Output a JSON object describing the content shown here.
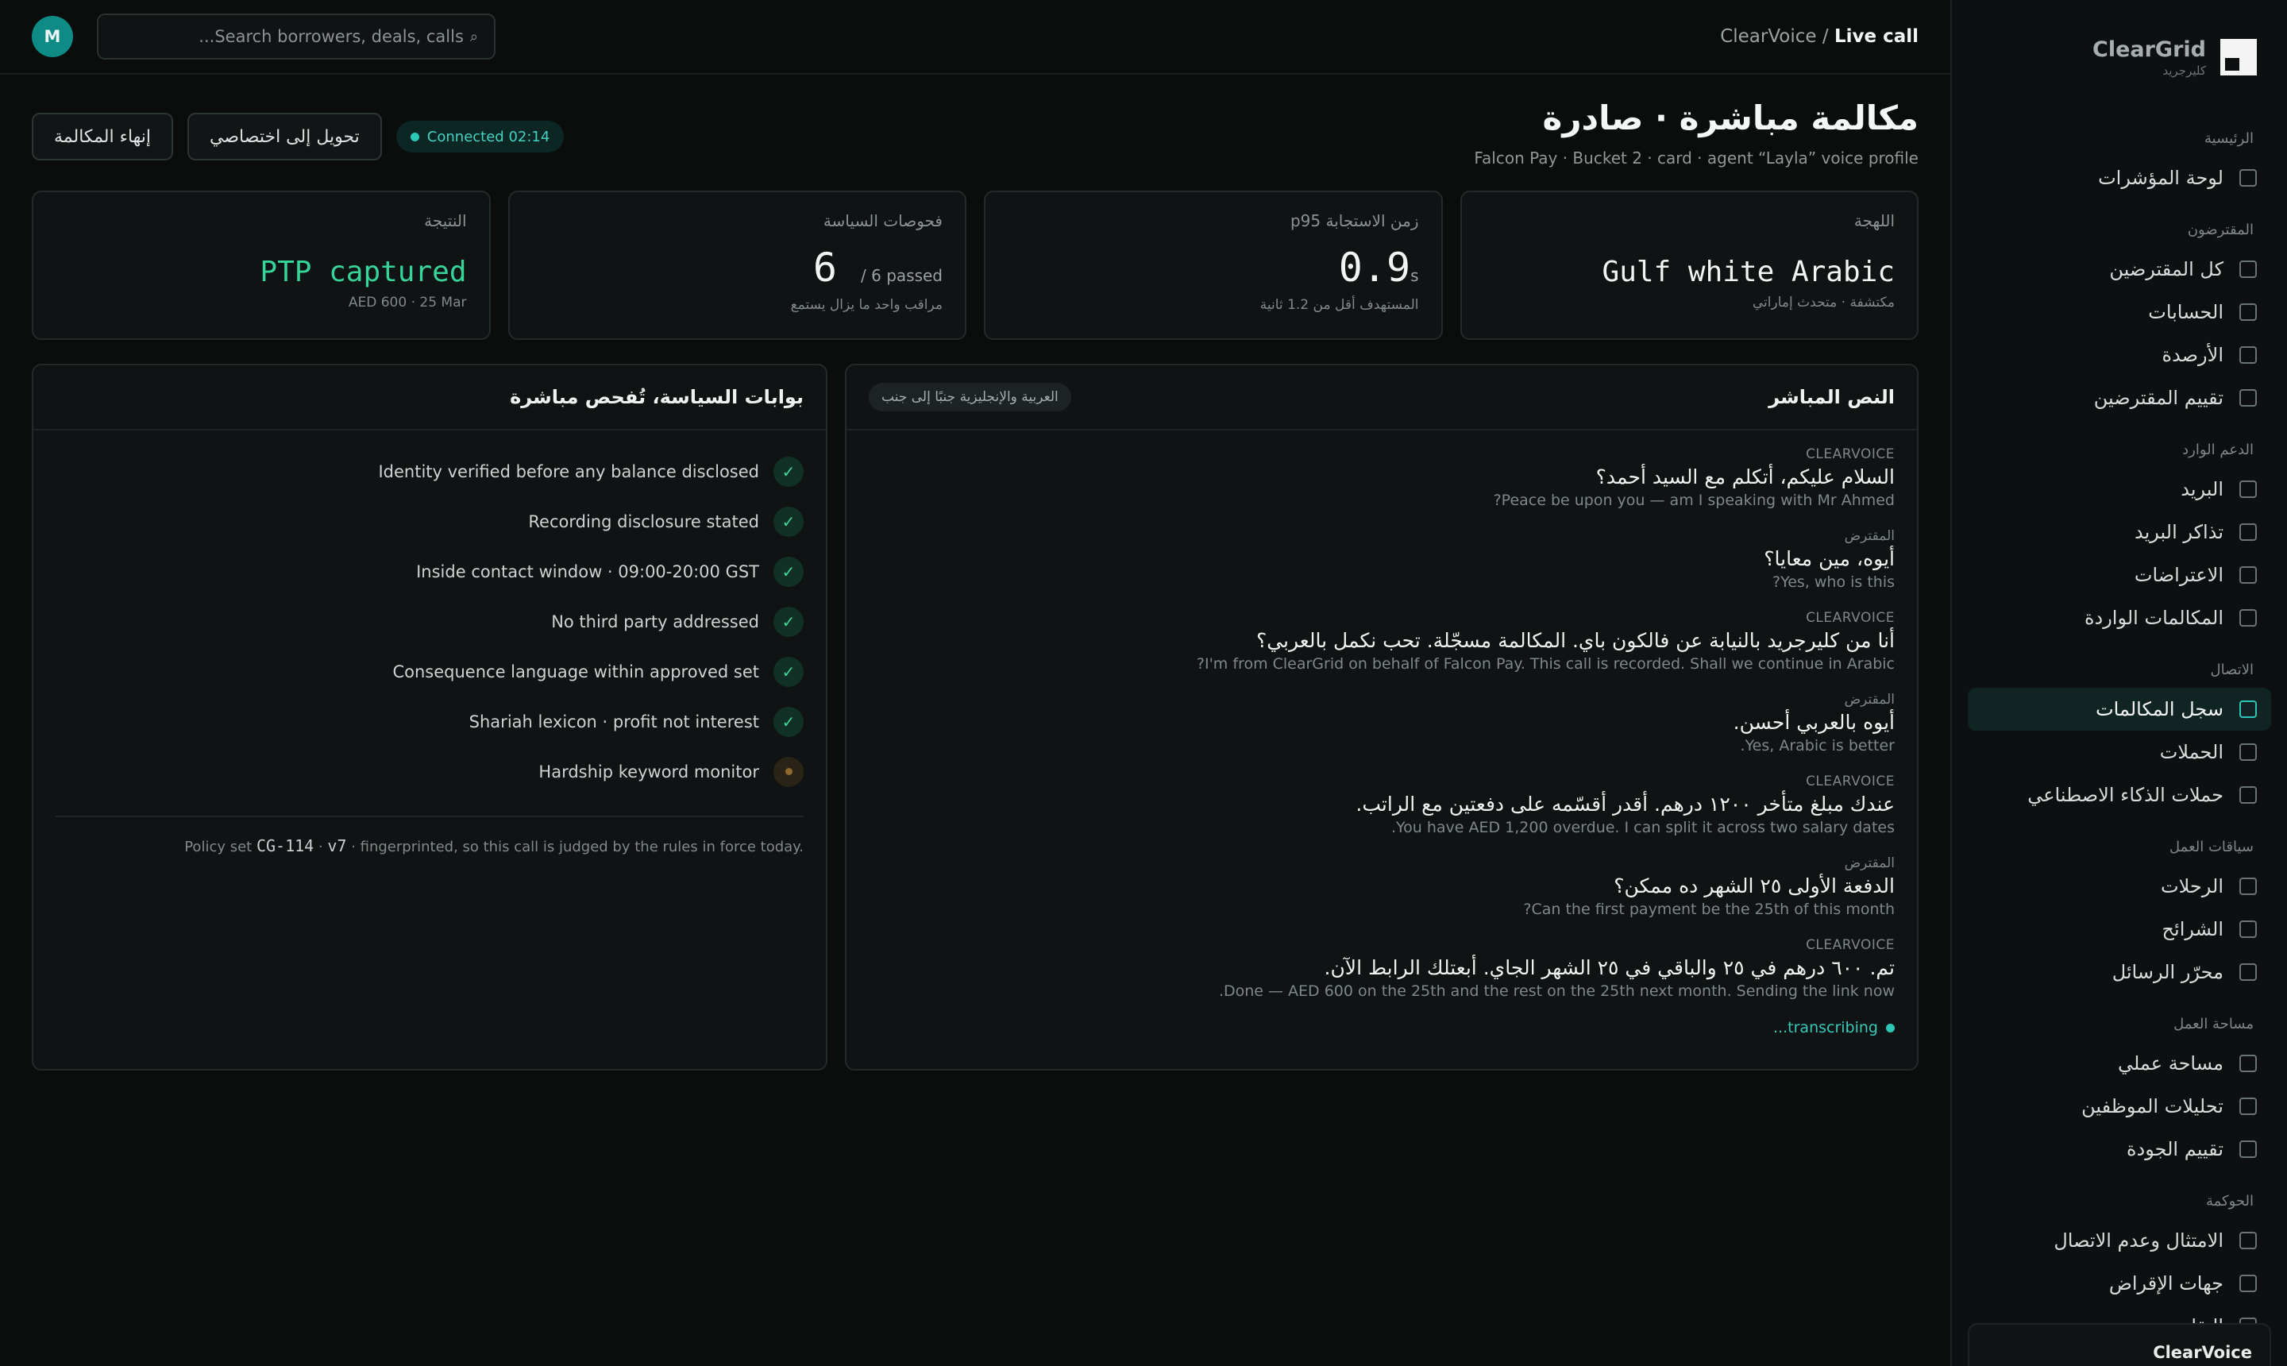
{
  "brand": {
    "name": "ClearGrid",
    "sub": "كليرجريد"
  },
  "sidebar": {
    "sections": [
      {
        "label": "الرئيسية",
        "items": [
          {
            "label": "لوحة المؤشرات",
            "active": false
          }
        ]
      },
      {
        "label": "المقترضون",
        "items": [
          {
            "label": "كل المقترضين",
            "active": false
          },
          {
            "label": "الحسابات",
            "active": false
          },
          {
            "label": "الأرصدة",
            "active": false
          },
          {
            "label": "تقييم المقترضين",
            "active": false
          }
        ]
      },
      {
        "label": "الدعم الوارد",
        "items": [
          {
            "label": "البريد",
            "active": false
          },
          {
            "label": "تذاكر البريد",
            "active": false
          },
          {
            "label": "الاعتراضات",
            "active": false
          },
          {
            "label": "المكالمات الواردة",
            "active": false
          }
        ]
      },
      {
        "label": "الاتصال",
        "items": [
          {
            "label": "سجل المكالمات",
            "active": true
          },
          {
            "label": "الحملات",
            "active": false
          },
          {
            "label": "حملات الذكاء الاصطناعي",
            "active": false
          }
        ]
      },
      {
        "label": "سياقات العمل",
        "items": [
          {
            "label": "الرحلات",
            "active": false
          },
          {
            "label": "الشرائح",
            "active": false
          },
          {
            "label": "محرّر الرسائل",
            "active": false
          }
        ]
      },
      {
        "label": "مساحة العمل",
        "items": [
          {
            "label": "مساحة عملي",
            "active": false
          },
          {
            "label": "تحليلات الموظفين",
            "active": false
          },
          {
            "label": "تقييم الجودة",
            "active": false
          }
        ]
      },
      {
        "label": "الحوكمة",
        "items": [
          {
            "label": "الامتثال وعدم الاتصال",
            "active": false
          },
          {
            "label": "جهات الإقراض",
            "active": false
          },
          {
            "label": "التقارير",
            "active": false
          }
        ]
      }
    ],
    "footer": "ClearVoice"
  },
  "topbar": {
    "crumb_parent": "ClearVoice",
    "crumb_sep": " / ",
    "crumb_current": "Live call",
    "search_placeholder": "Search borrowers, deals, calls...",
    "avatar": "M"
  },
  "header": {
    "title": "مكالمة مباشرة · صادرة",
    "subtitle": "Falcon Pay · Bucket 2 · card · agent “Layla” voice profile",
    "status": "Connected 02:14",
    "transfer_button": "تحويل إلى اختصاصي",
    "end_button": "إنهاء المكالمة"
  },
  "stats": {
    "dialect": {
      "label": "اللهجة",
      "value": "Gulf white Arabic",
      "sub": "مكتشفة · متحدث إماراتي"
    },
    "latency": {
      "label": "زمن الاستجابة p95",
      "value": "0.9",
      "unit": "s",
      "sub": "المستهدف أقل من 1.2 ثانية"
    },
    "policy": {
      "label": "فحوصات السياسة",
      "value": "6",
      "unit": "/ 6 passed",
      "sub": "مراقب واحد ما يزال يستمع"
    },
    "outcome": {
      "label": "النتيجة",
      "value": "PTP captured",
      "sub": "AED 600 · 25 Mar"
    }
  },
  "transcript": {
    "title": "النص المباشر",
    "chip": "العربية والإنجليزية جنبًا إلى جنب",
    "turns": [
      {
        "who": "CLEARVOICE",
        "ar": "السلام عليكم، أتكلم مع السيد أحمد؟",
        "en": "Peace be upon you — am I speaking with Mr Ahmed?"
      },
      {
        "who": "المقترض",
        "ar": "أيوه، مين معايا؟",
        "en": "Yes, who is this?"
      },
      {
        "who": "CLEARVOICE",
        "ar": "أنا من كليرجريد بالنيابة عن فالكون باي. المكالمة مسجّلة. تحب نكمل بالعربي؟",
        "en": "I'm from ClearGrid on behalf of Falcon Pay. This call is recorded. Shall we continue in Arabic?"
      },
      {
        "who": "المقترض",
        "ar": "أيوه بالعربي أحسن.",
        "en": "Yes, Arabic is better."
      },
      {
        "who": "CLEARVOICE",
        "ar": "عندك مبلغ متأخر ١٢٠٠ درهم. أقدر أقسّمه على دفعتين مع الراتب.",
        "en": "You have AED 1,200 overdue. I can split it across two salary dates."
      },
      {
        "who": "المقترض",
        "ar": "الدفعة الأولى ٢٥ الشهر ده ممكن؟",
        "en": "Can the first payment be the 25th of this month?"
      },
      {
        "who": "CLEARVOICE",
        "ar": "تم. ٦٠٠ درهم في ٢٥ والباقي في ٢٥ الشهر الجاي. أبعتلك الرابط الآن.",
        "en": "Done — AED 600 on the 25th and the rest on the 25th next month. Sending the link now."
      }
    ],
    "live_label": "transcribing..."
  },
  "policy": {
    "title": "بوابات السياسة، تُفحص مباشرة",
    "gates": [
      {
        "label": "Identity verified before any balance disclosed",
        "passed": true
      },
      {
        "label": "Recording disclosure stated",
        "passed": true
      },
      {
        "label": "Inside contact window · 09:00-20:00 GST",
        "passed": true
      },
      {
        "label": "No third party addressed",
        "passed": true
      },
      {
        "label": "Consequence language within approved set",
        "passed": true
      },
      {
        "label": "Shariah lexicon · profit not interest",
        "passed": true
      },
      {
        "label": "Hardship keyword monitor",
        "passed": false
      }
    ],
    "check_glyph": "✓",
    "footer_prefix": "Policy set ",
    "footer_id": "CG-114",
    "footer_dot": " · ",
    "footer_version": "v7",
    "footer_suffix": " · fingerprinted, so this call is judged by the rules in force today."
  }
}
